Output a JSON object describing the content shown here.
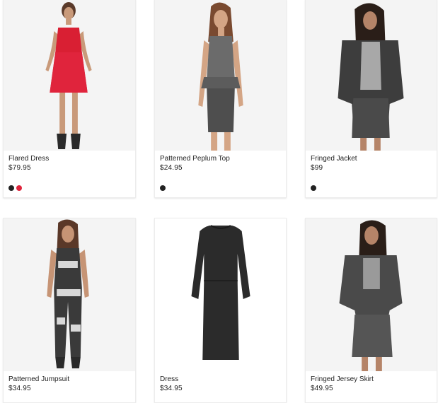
{
  "products": [
    {
      "name": "Flared Dress",
      "price": "$79.95",
      "swatches": [
        "#222222",
        "#e0243c"
      ],
      "image": "flared-dress-photo"
    },
    {
      "name": "Patterned Peplum Top",
      "price": "$24.95",
      "swatches": [
        "#222222"
      ],
      "image": "peplum-top-photo"
    },
    {
      "name": "Fringed Jacket",
      "price": "$99",
      "swatches": [
        "#222222"
      ],
      "image": "fringed-jacket-photo"
    },
    {
      "name": "Patterned Jumpsuit",
      "price": "$34.95",
      "swatches": [],
      "image": "jumpsuit-photo"
    },
    {
      "name": "Dress",
      "price": "$34.95",
      "swatches": [],
      "image": "black-dress-photo"
    },
    {
      "name": "Fringed Jersey Skirt",
      "price": "$49.95",
      "swatches": [],
      "image": "jersey-skirt-photo"
    }
  ]
}
